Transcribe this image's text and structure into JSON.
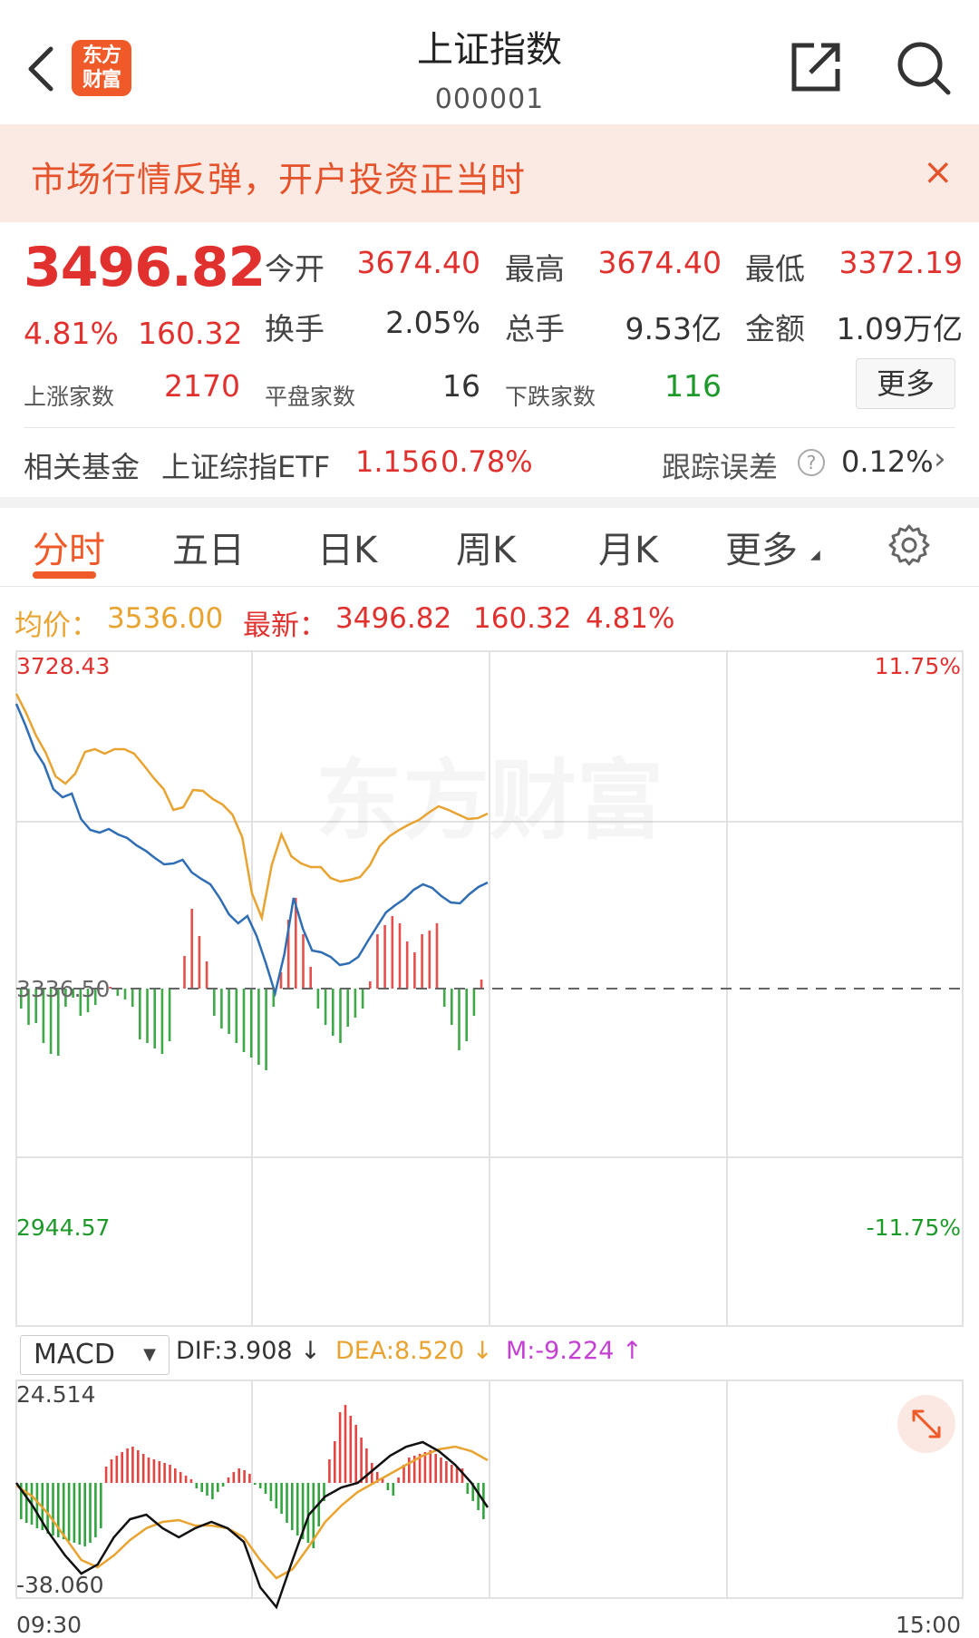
{
  "header": {
    "logo_line1": "东方",
    "logo_line2": "财富",
    "title": "上证指数",
    "code": "000001"
  },
  "banner": {
    "text": "市场行情反弹，开户投资正当时",
    "close": "×"
  },
  "quote": {
    "price": "3496.82",
    "change_pct": "4.81%",
    "change": "160.32",
    "open_label": "今开",
    "open": "3674.40",
    "high_label": "最高",
    "high": "3674.40",
    "low_label": "最低",
    "low": "3372.19",
    "turnover_label": "换手",
    "turnover": "2.05%",
    "volume_label": "总手",
    "volume": "9.53亿",
    "amount_label": "金额",
    "amount": "1.09万亿",
    "up_label": "上涨家数",
    "up": "2170",
    "flat_label": "平盘家数",
    "flat": "16",
    "down_label": "下跌家数",
    "down": "116",
    "more": "更多"
  },
  "fund": {
    "label": "相关基金",
    "name": "上证综指ETF",
    "price": "1.156",
    "pct": "0.78%",
    "track_label": "跟踪误差",
    "track_value": "0.12%"
  },
  "tabs": [
    "分时",
    "五日",
    "日K",
    "周K",
    "月K",
    "更多"
  ],
  "info": {
    "avg_label": "均价：",
    "avg": "3536.00",
    "latest_label": "最新：",
    "latest": "3496.82",
    "latest_change": "160.32",
    "latest_pct": "4.81%"
  },
  "chart_labels": {
    "top_price": "3728.43",
    "top_pct": "11.75%",
    "base": "3336.50",
    "bottom_price": "2944.57",
    "bottom_pct": "-11.75%",
    "watermark": "东方财富"
  },
  "macd": {
    "selector": "MACD",
    "dif": "DIF:3.908 ↓",
    "dea": "DEA:8.520 ↓",
    "m": "M:-9.224 ↑",
    "top": "24.514",
    "bottom": "-38.060",
    "time_start": "09:30",
    "time_end": "15:00"
  },
  "colors": {
    "brand": "#ef5a28",
    "up": "#e0312e",
    "down": "#1d9a2a",
    "price_line": "#2f6db5",
    "avg_line": "#e8a331",
    "dea": "#e8a331",
    "m": "#c43fd3"
  }
}
